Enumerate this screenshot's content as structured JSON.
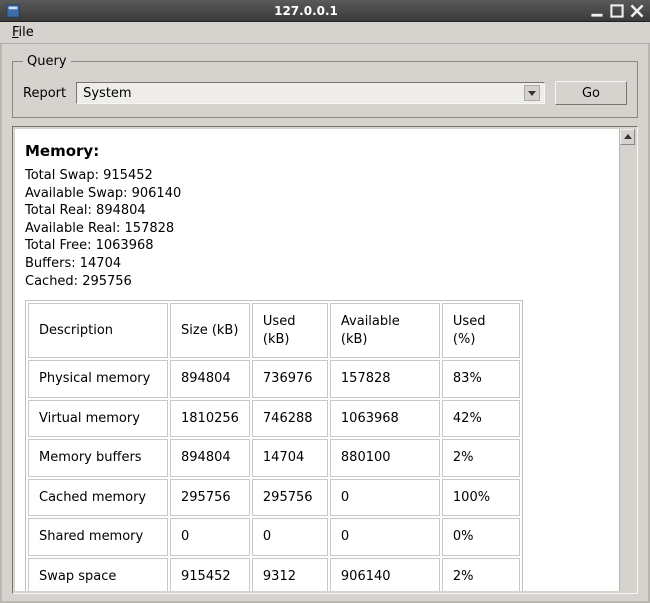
{
  "window": {
    "title": "127.0.0.1"
  },
  "menu": {
    "file_prefix": "F",
    "file_rest": "ile"
  },
  "query": {
    "legend": "Query",
    "report_label": "Report",
    "report_value": "System",
    "go_label": "Go"
  },
  "memory": {
    "heading": "Memory:",
    "stats": {
      "total_swap_label": "Total Swap:",
      "total_swap": "915452",
      "avail_swap_label": "Available Swap:",
      "avail_swap": "906140",
      "total_real_label": "Total Real:",
      "total_real": "894804",
      "avail_real_label": "Available Real:",
      "avail_real": "157828",
      "total_free_label": "Total Free:",
      "total_free": "1063968",
      "buffers_label": "Buffers:",
      "buffers": "14704",
      "cached_label": "Cached:",
      "cached": "295756"
    },
    "table": {
      "headers": {
        "description": "Description",
        "size": "Size (kB)",
        "used": "Used (kB)",
        "available": "Available (kB)",
        "used_pct": "Used (%)"
      },
      "rows": [
        {
          "description": "Physical memory",
          "size": "894804",
          "used": "736976",
          "available": "157828",
          "used_pct": "83%"
        },
        {
          "description": "Virtual memory",
          "size": "1810256",
          "used": "746288",
          "available": "1063968",
          "used_pct": "42%"
        },
        {
          "description": "Memory buffers",
          "size": "894804",
          "used": "14704",
          "available": "880100",
          "used_pct": "2%"
        },
        {
          "description": "Cached memory",
          "size": "295756",
          "used": "295756",
          "available": "0",
          "used_pct": "100%"
        },
        {
          "description": "Shared memory",
          "size": "0",
          "used": "0",
          "available": "0",
          "used_pct": "0%"
        },
        {
          "description": "Swap space",
          "size": "915452",
          "used": "9312",
          "available": "906140",
          "used_pct": "2%"
        }
      ]
    }
  }
}
